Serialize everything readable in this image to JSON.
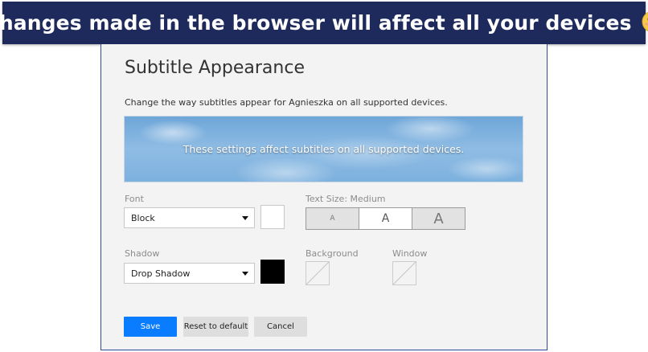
{
  "banner": {
    "text": "Changes made in the browser will affect all your devices",
    "emoji_icon": "smiling-face-emoji-icon",
    "color": "#1d2a5b"
  },
  "settings": {
    "title": "Subtitle Appearance",
    "description": "Change the way subtitles appear for Agnieszka on all supported devices.",
    "preview_text": "These settings affect subtitles on all supported devices.",
    "font": {
      "label": "Font",
      "selected": "Block",
      "color": "#ffffff"
    },
    "text_size": {
      "label": "Text Size: Medium",
      "options": [
        "A",
        "A",
        "A"
      ],
      "selected": "Medium"
    },
    "shadow": {
      "label": "Shadow",
      "selected": "Drop Shadow",
      "color": "#000000"
    },
    "background": {
      "label": "Background"
    },
    "window": {
      "label": "Window"
    },
    "buttons": {
      "save": "Save",
      "reset": "Reset to default",
      "cancel": "Cancel"
    },
    "accent_color": "#0a7cff"
  }
}
